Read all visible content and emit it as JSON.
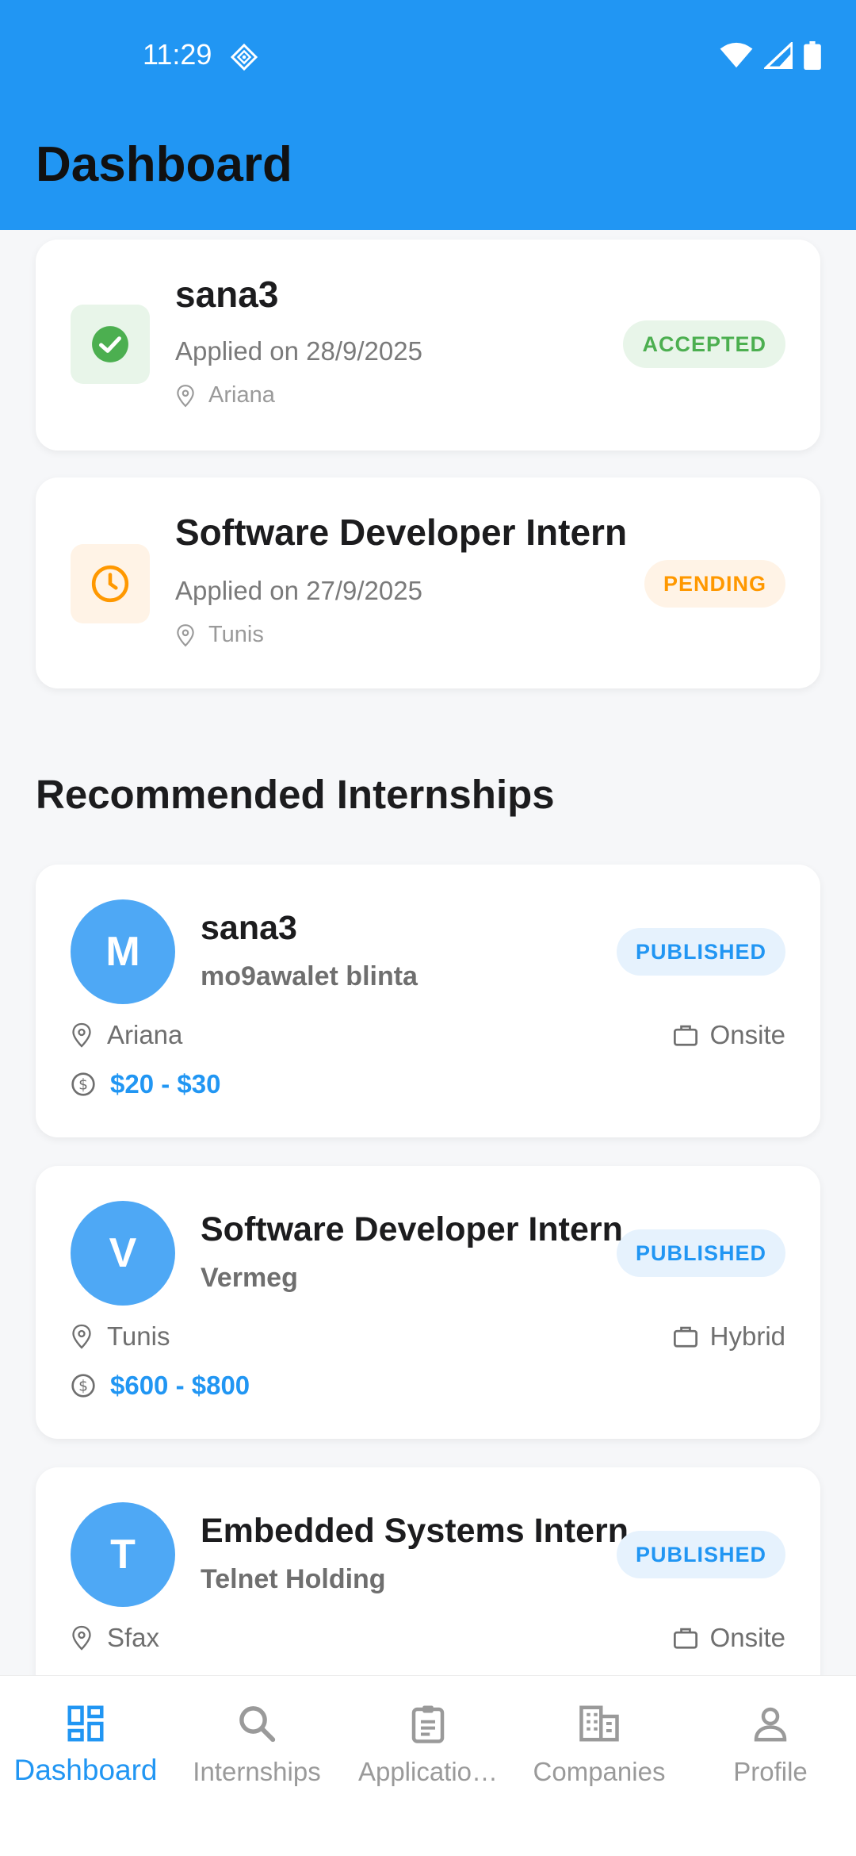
{
  "status_bar": {
    "time": "11:29"
  },
  "header": {
    "title": "Dashboard"
  },
  "applications": [
    {
      "title": "sana3",
      "date": "Applied on 28/9/2025",
      "location": "Ariana",
      "status": "ACCEPTED",
      "status_color": "#4caf50",
      "icon": "check-circle-icon"
    },
    {
      "title": "Software Developer Intern",
      "date": "Applied on 27/9/2025",
      "location": "Tunis",
      "status": "PENDING",
      "status_color": "#ff9800",
      "icon": "clock-icon"
    }
  ],
  "recommended": {
    "title": "Recommended Internships",
    "items": [
      {
        "initial": "M",
        "title": "sana3",
        "company": "mo9awalet blinta",
        "status": "PUBLISHED",
        "location": "Ariana",
        "work_type": "Onsite",
        "salary": "$20 - $30"
      },
      {
        "initial": "V",
        "title": "Software Developer Intern",
        "company": "Vermeg",
        "status": "PUBLISHED",
        "location": "Tunis",
        "work_type": "Hybrid",
        "salary": "$600 - $800"
      },
      {
        "initial": "T",
        "title": "Embedded Systems Intern",
        "company": "Telnet Holding",
        "status": "PUBLISHED",
        "location": "Sfax",
        "work_type": "Onsite"
      }
    ]
  },
  "bottom_nav": {
    "items": [
      {
        "label": "Dashboard",
        "icon": "dashboard-icon",
        "active": true
      },
      {
        "label": "Internships",
        "icon": "search-icon"
      },
      {
        "label": "Applicatio…",
        "icon": "clipboard-icon"
      },
      {
        "label": "Companies",
        "icon": "building-icon"
      },
      {
        "label": "Profile",
        "icon": "person-icon"
      }
    ]
  },
  "colors": {
    "primary": "#2196f3",
    "accepted": "#4caf50",
    "pending": "#ff9800"
  }
}
